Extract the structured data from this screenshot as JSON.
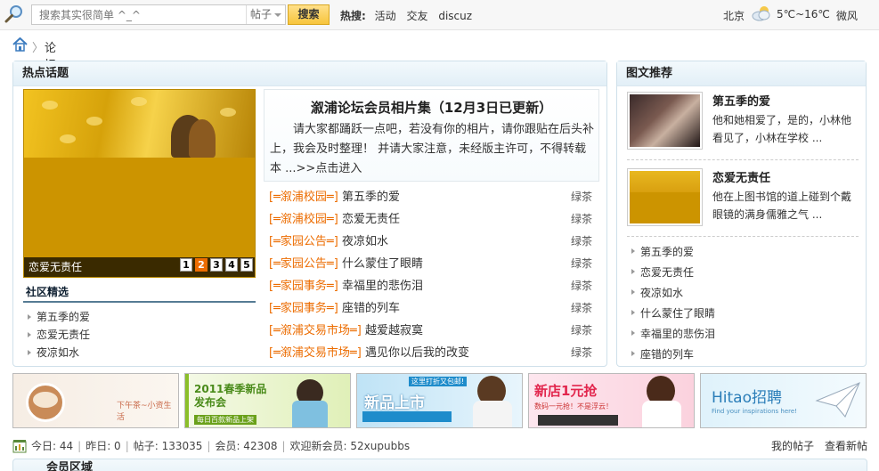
{
  "topbar": {
    "search_placeholder": "搜索其实很简单 ^_^",
    "search_type": "帖子",
    "search_button": "搜索",
    "hot_label": "热搜:",
    "hot_words": [
      "活动",
      "交友",
      "discuz"
    ],
    "weather": {
      "city": "北京",
      "temp": "5℃~16℃",
      "wind": "微风"
    }
  },
  "breadcrumb": {
    "current": "论坛"
  },
  "hot_panel": {
    "title": "热点话题",
    "slide_caption": "恋爱无责任",
    "slide_pages": [
      "1",
      "2",
      "3",
      "4",
      "5"
    ],
    "slide_active": "2",
    "selected_title": "社区精选",
    "selected_items": [
      "第五季的爱",
      "恋爱无责任",
      "夜凉如水"
    ],
    "feature_title": "溆浦论坛会员相片集（12月3日已更新）",
    "feature_desc": "请大家都踊跃一点吧，若没有你的相片，请你跟贴在后头补上，我会及时整理！ 并请大家注意，未经版主许可，不得转载本 ...",
    "feature_more": ">>点击进入",
    "topics": [
      {
        "cat": "[═溆浦校园═]",
        "title": "第五季的爱",
        "author": "绿茶"
      },
      {
        "cat": "[═溆浦校园═]",
        "title": "恋爱无责任",
        "author": "绿茶"
      },
      {
        "cat": "[═家园公告═]",
        "title": "夜凉如水",
        "author": "绿茶"
      },
      {
        "cat": "[═家园公告═]",
        "title": "什么蒙住了眼睛",
        "author": "绿茶"
      },
      {
        "cat": "[═家园事务═]",
        "title": "幸福里的悲伤泪",
        "author": "绿茶"
      },
      {
        "cat": "[═家园事务═]",
        "title": "座错的列车",
        "author": "绿茶"
      },
      {
        "cat": "[═溆浦交易市场═]",
        "title": "越爱越寂寞",
        "author": "绿茶"
      },
      {
        "cat": "[═溆浦交易市场═]",
        "title": "遇见你以后我的改变",
        "author": "绿茶"
      }
    ]
  },
  "pic_panel": {
    "title": "图文推荐",
    "items": [
      {
        "title": "第五季的爱",
        "desc": "他和她相爱了，是的，小林他看见了，小林在学校 ..."
      },
      {
        "title": "恋爱无责任",
        "desc": "他在上图书馆的道上碰到个戴眼镜的满身儒雅之气 ..."
      }
    ],
    "list": [
      "第五季的爱",
      "恋爱无责任",
      "夜凉如水",
      "什么蒙住了眼睛",
      "幸福里的悲伤泪",
      "座错的列车"
    ]
  },
  "banners": [
    {
      "text": "下午茶~小资生活"
    },
    {
      "text": "2011春季新品发布会",
      "sub": "每日百款新品上架"
    },
    {
      "text": "新品上市",
      "sub": "这里打折又包邮!"
    },
    {
      "text": "新店1元抢",
      "sub": "数码一元抢！不是浮云！"
    },
    {
      "text": "Hitao招聘",
      "sub": "Find your inspirations here!"
    }
  ],
  "stats": {
    "today_label": "今日: 44",
    "yesterday_label": "昨日: 0",
    "posts_label": "帖子: 133035",
    "members_label": "会员: 42308",
    "welcome": "欢迎新会员: 52xupubbs",
    "my_posts": "我的帖子",
    "new_posts": "查看新帖"
  },
  "bottom_panel": {
    "title": "会员区域"
  },
  "colors": {
    "accent": "#ec6c00",
    "panel_border": "#cfe0ea",
    "button": "#f7c53c"
  }
}
